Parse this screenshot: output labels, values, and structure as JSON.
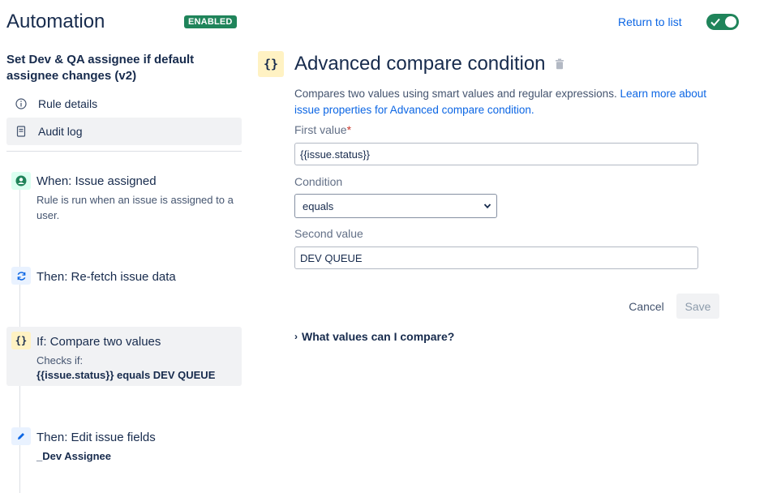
{
  "header": {
    "title": "Automation",
    "status_badge": "ENABLED",
    "return_link": "Return to list",
    "toggle_on": true
  },
  "sidebar": {
    "rule_name": "Set Dev & QA assignee if default assignee changes (v2)",
    "links": [
      {
        "label": "Rule details",
        "icon": "info-icon"
      },
      {
        "label": "Audit log",
        "icon": "document-icon"
      }
    ],
    "steps": [
      {
        "title": "When: Issue assigned",
        "desc": "Rule is run when an issue is assigned to a user.",
        "icon": "trigger-user-icon"
      },
      {
        "title": "Then: Re-fetch issue data",
        "icon": "refresh-icon"
      },
      {
        "title": "If: Compare two values",
        "desc": "Checks if:",
        "detail": "{{issue.status}} equals DEV QUEUE",
        "icon": "condition-braces-icon"
      },
      {
        "title": "Then: Edit issue fields",
        "detail": "_Dev Assignee",
        "icon": "edit-pencil-icon"
      }
    ]
  },
  "panel": {
    "icon_text": "{}",
    "title": "Advanced compare condition",
    "desc_prefix": "Compares two values using smart values and regular expressions.",
    "desc_link": "Learn more about issue properties for Advanced compare condition.",
    "first_value_label": "First value",
    "required_mark": "*",
    "first_value": "{{issue.status}}",
    "condition_label": "Condition",
    "condition_value": "equals",
    "second_value_label": "Second value",
    "second_value": "DEV QUEUE",
    "cancel_label": "Cancel",
    "save_label": "Save",
    "expander_label": "What values can I compare?"
  },
  "colors": {
    "accent": "#0c66e4",
    "enabled_green": "#1f845a",
    "condition_yellow": "#fff2c3"
  }
}
